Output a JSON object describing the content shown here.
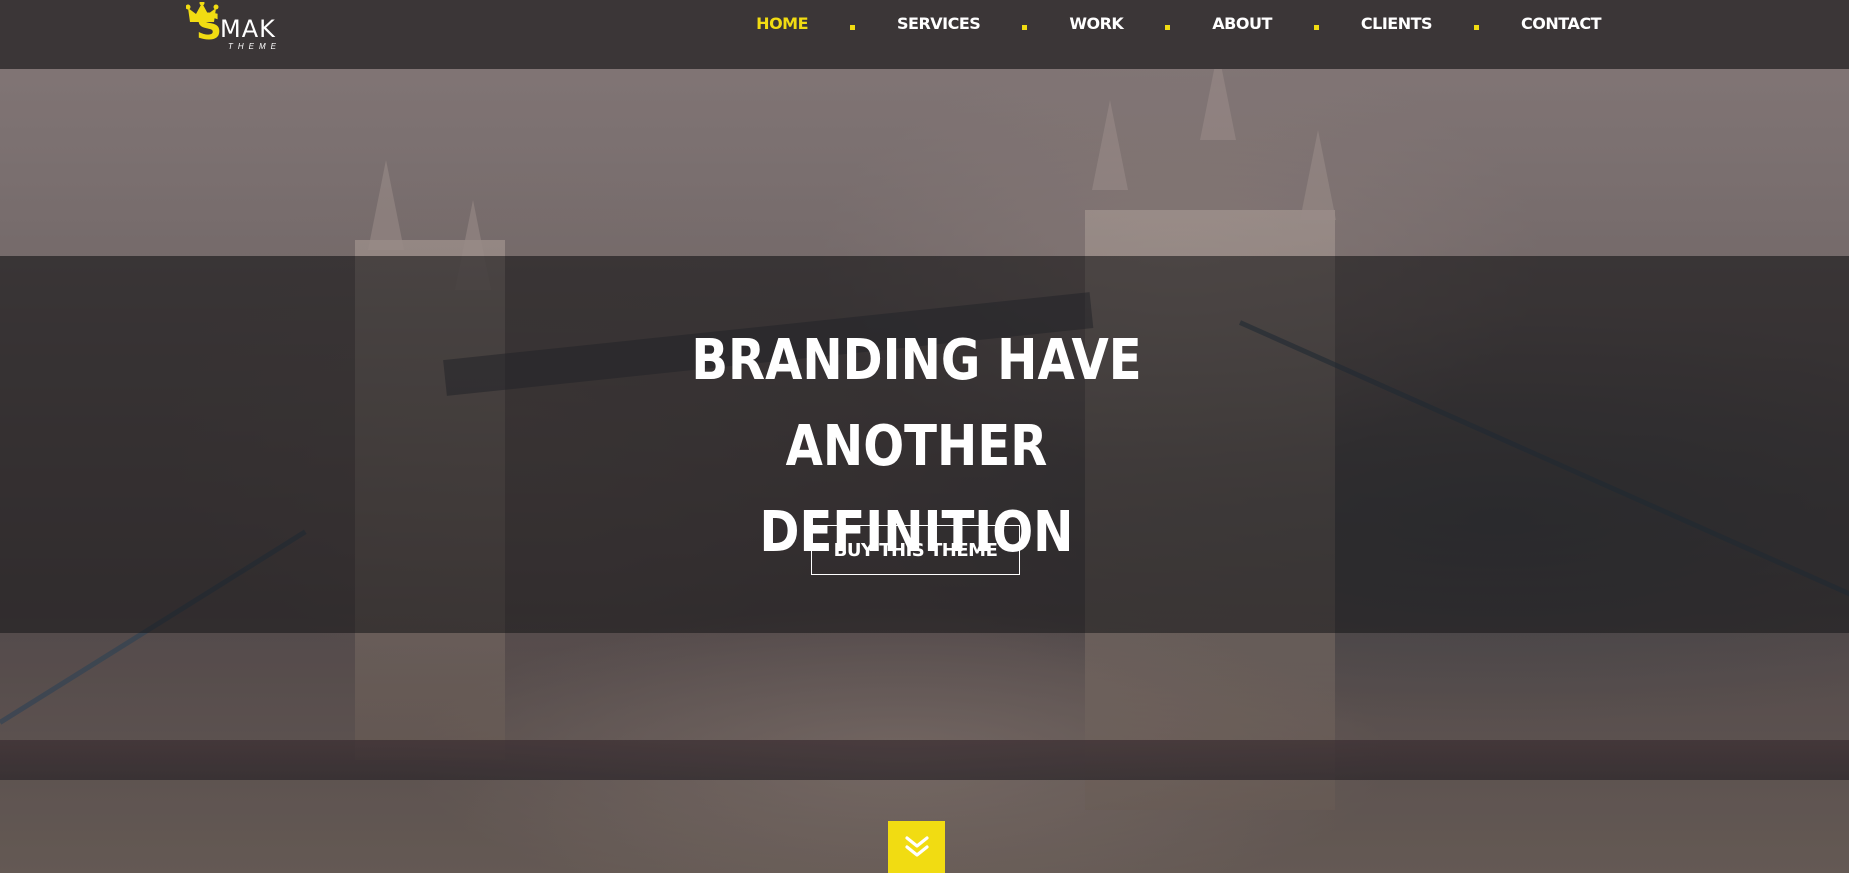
{
  "brand": {
    "logo_initial": "S",
    "logo_name": "MAK",
    "logo_tagline": "THEME"
  },
  "nav": {
    "items": [
      {
        "label": "HOME",
        "active": true
      },
      {
        "label": "SERVICES",
        "active": false
      },
      {
        "label": "WORK",
        "active": false
      },
      {
        "label": "ABOUT",
        "active": false
      },
      {
        "label": "CLIENTS",
        "active": false
      },
      {
        "label": "CONTACT",
        "active": false
      }
    ]
  },
  "hero": {
    "title_line1": "BRANDING HAVE ANOTHER",
    "title_line2": "DEFINITION",
    "cta_label": "BUY THIS THEME"
  },
  "icons": {
    "scroll": "double-chevron-down-icon",
    "crown": "crown-icon"
  },
  "colors": {
    "accent": "#f1dc12",
    "navbar": "#3b3637",
    "text": "#ffffff"
  }
}
